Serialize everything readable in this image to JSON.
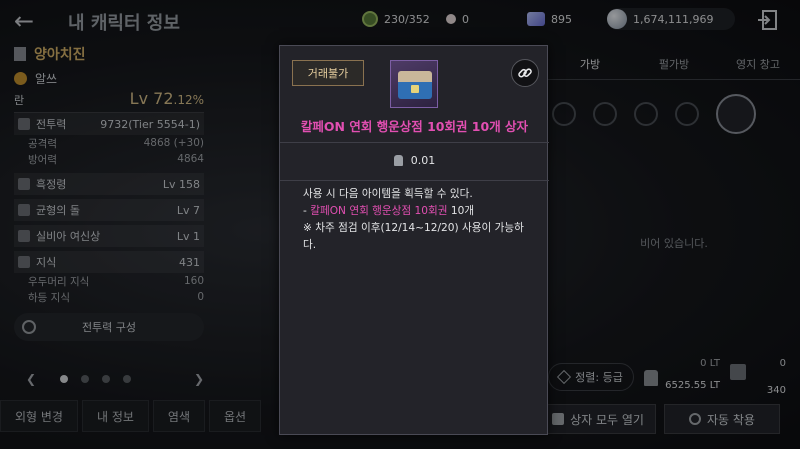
{
  "header": {
    "title": "내 캐릭터 정보",
    "energy": "230/352",
    "pearls": "0",
    "crystals": "895",
    "silver": "1,674,111,969"
  },
  "character": {
    "name": "양아치진",
    "class_name": "알쓰",
    "sub_label": "란",
    "level": "Lv 72",
    "level_pct": ".12%",
    "combat_power_label": "전투력",
    "combat_power_value": "9732(Tier 5554-1)",
    "attack_label": "공격력",
    "attack_value": "4868 (+30)",
    "defense_label": "방어력",
    "defense_value": "4864",
    "stats": [
      {
        "label": "흑정령",
        "value": "Lv 158"
      },
      {
        "label": "균형의 돌",
        "value": "Lv 7"
      },
      {
        "label": "실비아 여신상",
        "value": "Lv 1"
      },
      {
        "label": "지식",
        "value": "431"
      }
    ],
    "knowledge_sub": [
      {
        "label": "우두머리 지식",
        "value": "160"
      },
      {
        "label": "하등 지식",
        "value": "0"
      }
    ],
    "build_button": "전투력 구성"
  },
  "bottom_tabs": [
    "외형 변경",
    "내 정보",
    "염색",
    "옵션"
  ],
  "right_panel": {
    "tabs": [
      "가방",
      "펄가방",
      "영지 창고"
    ],
    "empty_text": "비어 있습니다.",
    "sort_label": "정렬: 등급",
    "weight_current": "0 LT",
    "weight_max": "6525.55 LT",
    "slots_used": "0",
    "slots_max": "340",
    "open_all_label": "상자 모두 열기",
    "auto_equip_label": "자동 착용"
  },
  "item_popup": {
    "trade_badge": "거래불가",
    "name": "칼페ON 연회 행운상점 10회권 10개 상자",
    "weight": "0.01",
    "desc_line1": "사용 시 다음 아이템을 획득할 수 있다.",
    "desc_item_prefix": " - ",
    "desc_item_name": "칼페ON 연회 행운상점 10회권",
    "desc_item_qty": " 10개",
    "desc_note": "※ 차주 점검 이후(12/14~12/20) 사용이 가능하다."
  },
  "colors": {
    "item_name": "#e24fb2",
    "trade_badge_text": "#e7cf9f",
    "level": "#d9c08a"
  }
}
